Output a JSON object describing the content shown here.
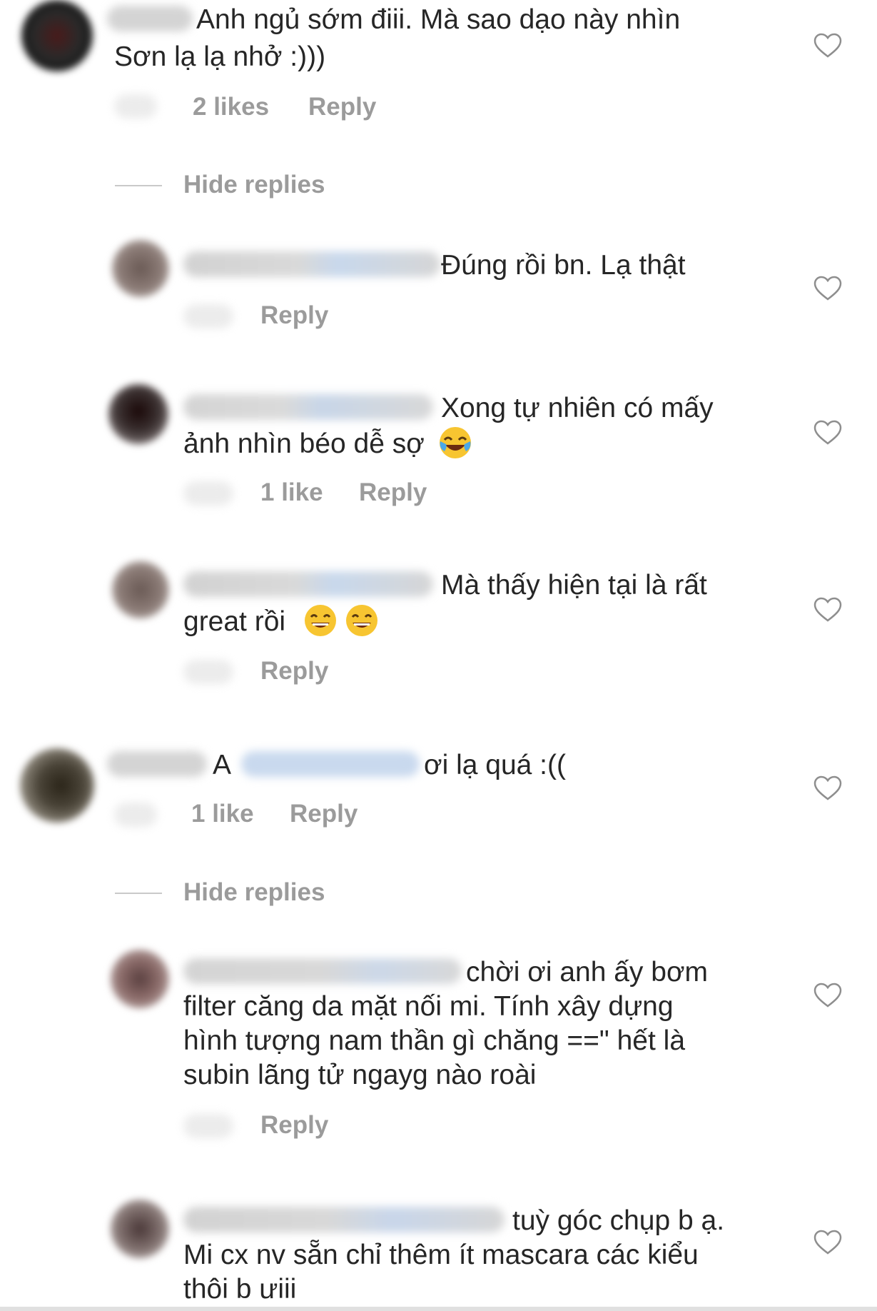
{
  "icons": {
    "like": "heart-outline-icon",
    "laugh_tears": "face-with-tears-of-joy-emoji",
    "grin": "grinning-face-with-smiling-eyes-emoji"
  },
  "colors": {
    "text": "#262626",
    "meta": "#9b9b9b",
    "heart_stroke": "#8e8e8e",
    "emoji_yellow": "#f7c531"
  },
  "comments": [
    {
      "text_lines": [
        "Anh ngủ sớm điii. Mà sao dạo này nhìn",
        "Sơn lạ lạ nhở :)))"
      ],
      "likes": "2 likes",
      "reply": "Reply"
    },
    {
      "hide_replies": "Hide replies"
    },
    {
      "text_lines": [
        "Đúng rồi bn. Lạ thật"
      ],
      "reply": "Reply"
    },
    {
      "text_lines": [
        "Xong tự nhiên có mấy",
        "ảnh nhìn béo dễ sợ"
      ],
      "likes": "1 like",
      "reply": "Reply"
    },
    {
      "text_lines": [
        "Mà thấy hiện tại là rất",
        "great rồi"
      ],
      "reply": "Reply"
    },
    {
      "text_parts": [
        "A",
        "ơi lạ quá :(("
      ],
      "likes": "1 like",
      "reply": "Reply"
    },
    {
      "hide_replies": "Hide replies"
    },
    {
      "text_lines": [
        "chời ơi  anh ấy bơm",
        "filter căng da mặt nối mi. Tính xây dựng",
        "hình tượng nam thần gì chăng ==\" hết là",
        "subin lãng tử ngayg nào roài"
      ],
      "reply": "Reply"
    },
    {
      "text_lines": [
        "tuỳ góc chụp b ạ.",
        "Mi cx nv sẵn chỉ thêm ít mascara các kiểu",
        "thôi b ưiii"
      ]
    }
  ]
}
